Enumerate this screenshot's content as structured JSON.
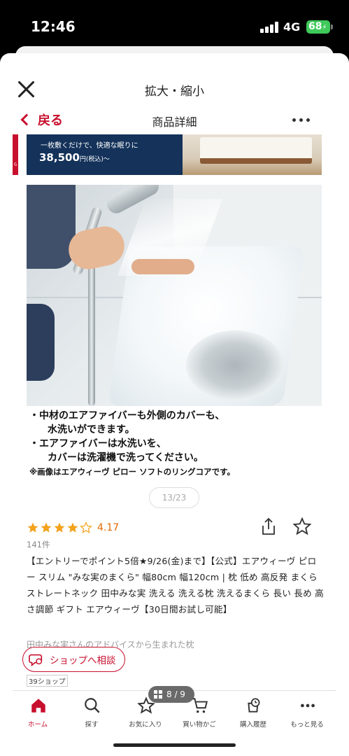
{
  "status_bar": {
    "time": "12:46",
    "network": "4G",
    "battery": "68"
  },
  "modal": {
    "title": "拡大・縮小"
  },
  "app": {
    "back_label": "戻る",
    "title": "商品詳細",
    "banner": {
      "line1": "一枚敷くだけで、快適な眠りに",
      "price": "38,500",
      "price_suffix": "円(税込)～"
    },
    "notes": [
      "・中材のエアファイバーも外側のカバーも、",
      "水洗いができます。",
      "・エアファイバーは水洗いを、",
      "カバーは洗濯機で洗ってください。",
      "※画像はエアウィーヴ ピロー ソフトのリングコアです。"
    ],
    "image_pager": "13/23",
    "rating": {
      "value": "4.17",
      "stars": 4,
      "review_count": "141件"
    },
    "product_title": "【エントリーでポイント5倍★9/26(金)まで】【公式】エアウィーヴ ピロー スリム \"みな実のまくら\" 幅80cm 幅120cm | 枕 低め 高反発 まくら ストレートネック 田中みな実 洗える 洗える枕 洗えるまくら 長い 長め 高さ調節 ギフト エアウィーヴ【30日間お試し可能】",
    "subtitle": "田中みな実さんのアドバイスから生まれた枕",
    "shop_button": "ショップへ相談",
    "shop_count": "39ショップ",
    "viewer_page": "8 / 9",
    "tabs": [
      {
        "label": "ホーム",
        "icon": "home-icon"
      },
      {
        "label": "探す",
        "icon": "search-icon"
      },
      {
        "label": "お気に入り",
        "icon": "star-icon"
      },
      {
        "label": "買い物かご",
        "icon": "cart-icon"
      },
      {
        "label": "購入履歴",
        "icon": "history-icon"
      },
      {
        "label": "もっと見る",
        "icon": "more-icon"
      }
    ]
  },
  "colors": {
    "accent": "#c8102e",
    "rating": "#e36a00",
    "battery": "#3ec95a",
    "banner": "#14325a"
  }
}
